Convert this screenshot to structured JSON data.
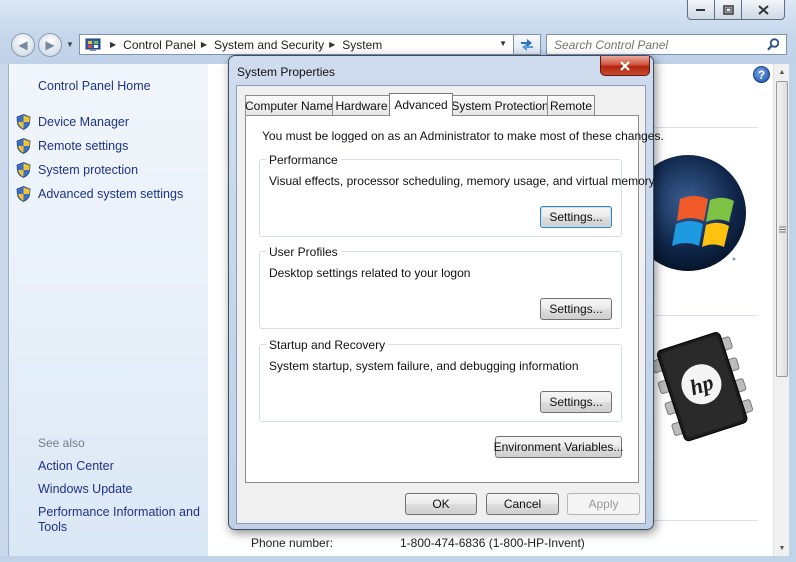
{
  "window": {
    "address": {
      "crumbs": [
        "Control Panel",
        "System and Security",
        "System"
      ]
    },
    "search": {
      "placeholder": "Search Control Panel"
    }
  },
  "left_pane": {
    "home_link": "Control Panel Home",
    "tasks": [
      {
        "label": "Device Manager",
        "icon": "uac-shield-icon"
      },
      {
        "label": "Remote settings",
        "icon": "uac-shield-icon"
      },
      {
        "label": "System protection",
        "icon": "uac-shield-icon"
      },
      {
        "label": "Advanced system settings",
        "icon": "uac-shield-icon"
      }
    ],
    "see_also": {
      "title": "See also",
      "links": [
        "Action Center",
        "Windows Update",
        "Performance Information and Tools"
      ]
    }
  },
  "main": {
    "phone_label": "Phone number:",
    "phone_value": "1-800-474-6836 (1-800-HP-Invent)"
  },
  "dialog": {
    "title": "System Properties",
    "tabs": [
      {
        "label": "Computer Name",
        "active": false
      },
      {
        "label": "Hardware",
        "active": false
      },
      {
        "label": "Advanced",
        "active": true
      },
      {
        "label": "System Protection",
        "active": false
      },
      {
        "label": "Remote",
        "active": false
      }
    ],
    "admin_note": "You must be logged on as an Administrator to make most of these changes.",
    "groups": [
      {
        "title": "Performance",
        "description": "Visual effects, processor scheduling, memory usage, and virtual memory",
        "button": "Settings..."
      },
      {
        "title": "User Profiles",
        "description": "Desktop settings related to your logon",
        "button": "Settings..."
      },
      {
        "title": "Startup and Recovery",
        "description": "System startup, system failure, and debugging information",
        "button": "Settings..."
      }
    ],
    "env_button": "Environment Variables...",
    "ok": "OK",
    "cancel": "Cancel",
    "apply": "Apply"
  },
  "colors": {
    "link": "#1e3287",
    "frame": "#c1d3e8",
    "close_red": "#c84a30"
  }
}
